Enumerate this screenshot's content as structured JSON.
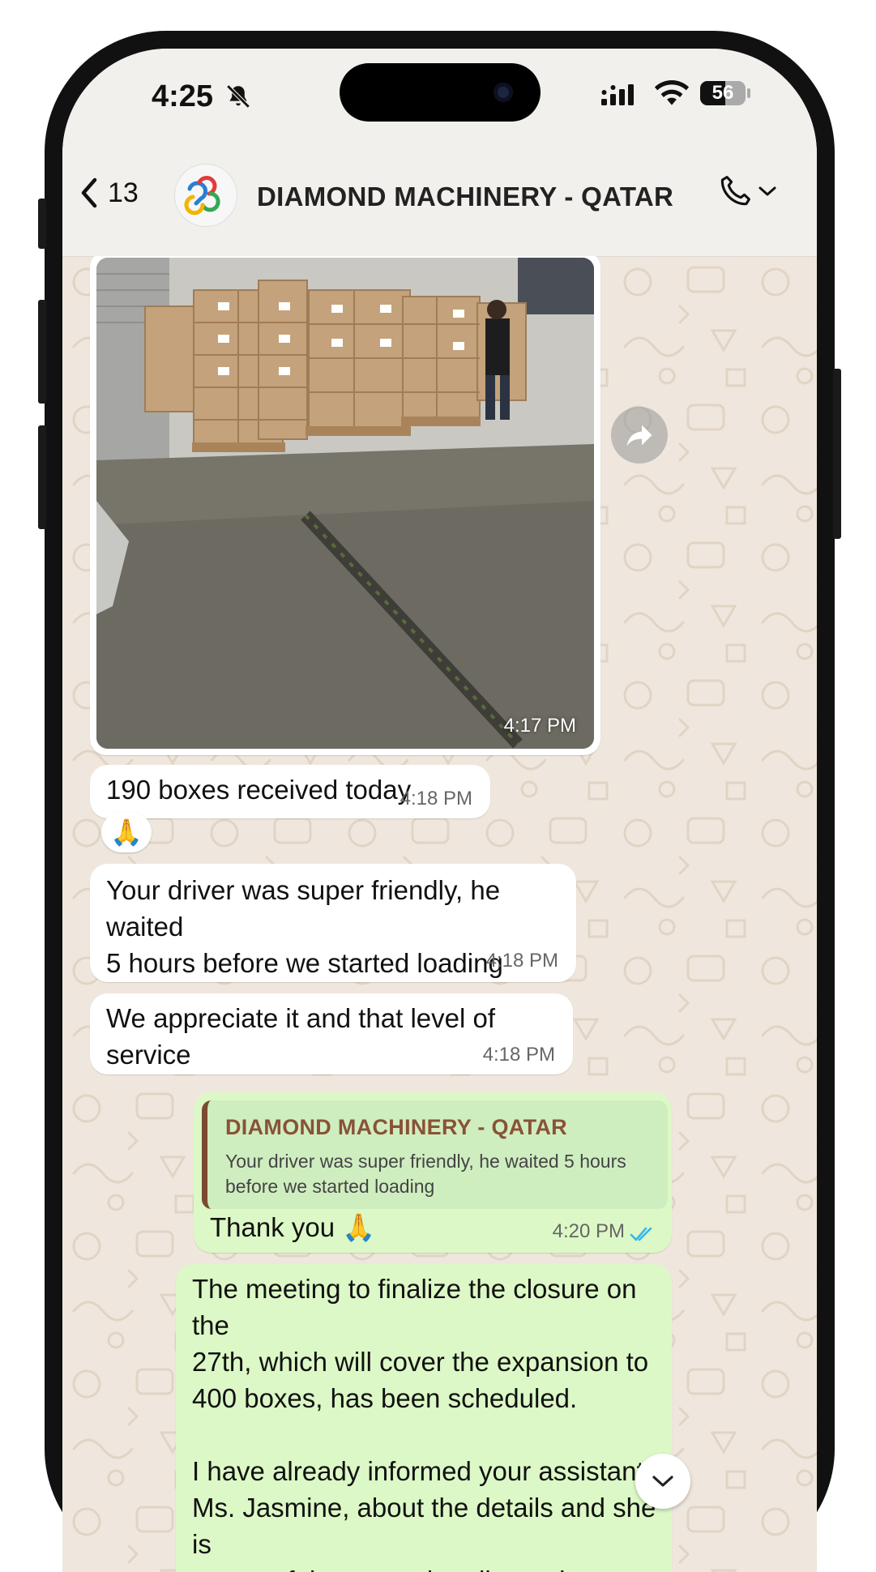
{
  "status_bar": {
    "time": "4:25",
    "battery_level": "56",
    "battery_fill_percent": 56,
    "icons": [
      "bell-slash-icon",
      "cellular-signal-icon",
      "wifi-icon",
      "battery-icon"
    ]
  },
  "header": {
    "back_count": "13",
    "contact_name": "DIAMOND MACHINERY - QATAR",
    "icons": [
      "chevron-left-icon",
      "phone-icon",
      "chevron-down-icon"
    ]
  },
  "messages": [
    {
      "type": "image",
      "direction": "incoming",
      "time": "4:17 PM"
    },
    {
      "type": "text",
      "direction": "incoming",
      "text": "190 boxes received today",
      "time": "4:18 PM",
      "reaction": "🙏"
    },
    {
      "type": "text",
      "direction": "incoming",
      "lines": [
        "Your driver was super friendly, he waited",
        "5 hours before we started loading"
      ],
      "time": "4:18 PM"
    },
    {
      "type": "text",
      "direction": "incoming",
      "text": "We appreciate it and that level of service",
      "time": "4:18 PM"
    },
    {
      "type": "reply",
      "direction": "outgoing",
      "quoted_name": "DIAMOND MACHINERY - QATAR",
      "quoted_lines": [
        "Your driver was super friendly, he waited 5 hours",
        "before we started loading"
      ],
      "text": "Thank you 🙏",
      "time": "4:20 PM",
      "status": "read"
    },
    {
      "type": "text",
      "direction": "outgoing",
      "lines": [
        "The meeting to finalize the closure on the",
        "27th, which will cover the expansion to",
        "400 boxes, has been scheduled.",
        "",
        "I have already informed your assistant,",
        "Ms. Jasmine, about the details and she is",
        "aware of the upcoming discussion."
      ]
    }
  ],
  "colors": {
    "chat_background": "#efe7dd",
    "incoming_bubble": "#ffffff",
    "outgoing_bubble": "#dcf8c6",
    "quote_accent": "#7b4a31",
    "read_ticks": "#34b7f1"
  }
}
